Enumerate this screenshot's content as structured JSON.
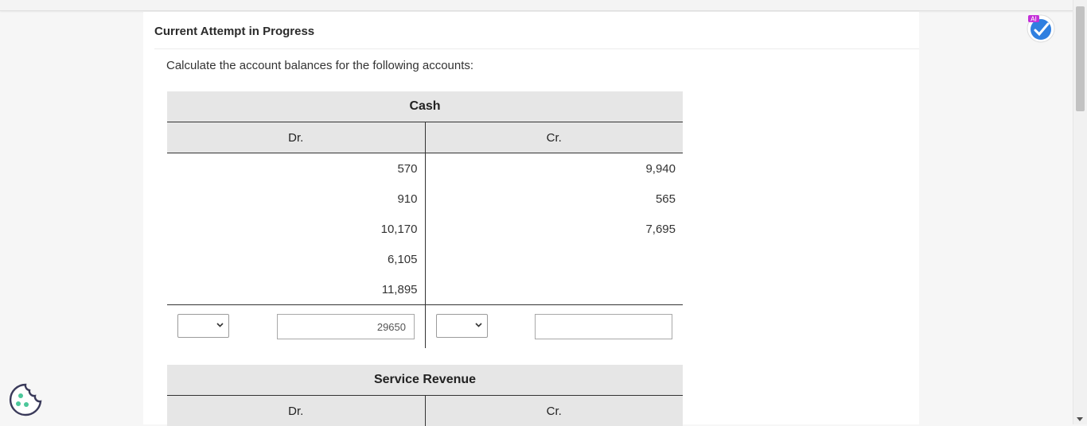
{
  "section": {
    "title": "Current Attempt in Progress"
  },
  "question": {
    "instruction": "Calculate the account balances for the following accounts:"
  },
  "accounts": [
    {
      "title": "Cash",
      "dr_label": "Dr.",
      "cr_label": "Cr.",
      "debits": [
        "570",
        "910",
        "10,170",
        "6,105",
        "11,895"
      ],
      "credits": [
        "9,940",
        "565",
        "7,695"
      ],
      "balance_input_value": "29650",
      "debit_select_value": "",
      "credit_select_value": "",
      "credit_balance_value": ""
    },
    {
      "title": "Service Revenue",
      "dr_label": "Dr.",
      "cr_label": "Cr."
    }
  ],
  "ai_badge": {
    "label": "AI"
  },
  "icons": {
    "cookie": "cookie-icon",
    "ai": "ai-assistant-icon",
    "chevron": "chevron-down-icon"
  }
}
